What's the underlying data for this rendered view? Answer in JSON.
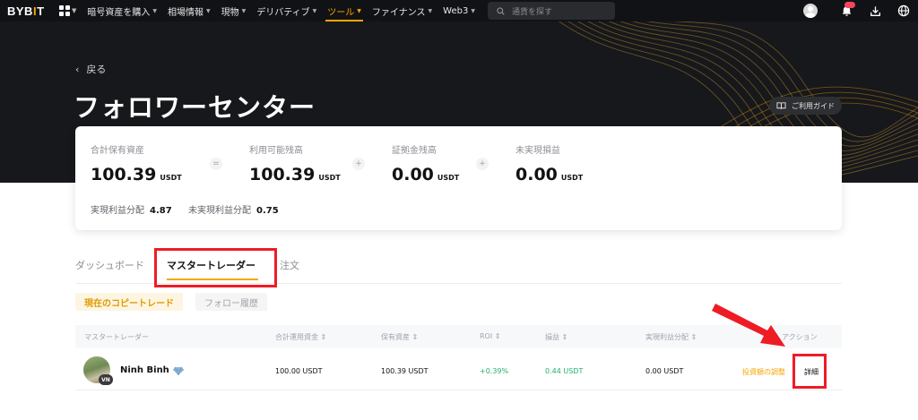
{
  "brand": {
    "logo_main": "BYB",
    "logo_i": "I",
    "logo_end": "T"
  },
  "nav": {
    "items": [
      {
        "label": "暗号資産を購入"
      },
      {
        "label": "相場情報"
      },
      {
        "label": "現物"
      },
      {
        "label": "デリバティブ"
      },
      {
        "label": "ツール"
      },
      {
        "label": "ファイナンス"
      },
      {
        "label": "Web3"
      }
    ],
    "active": "ツール",
    "search_placeholder": "通貨を探す"
  },
  "hero": {
    "back_label": "戻る",
    "title": "フォロワーセンター",
    "guide_label": "ご利用ガイド"
  },
  "summary": {
    "total_assets": {
      "label": "合計保有資産",
      "value": "100.39",
      "unit": "USDT"
    },
    "available": {
      "label": "利用可能残高",
      "value": "100.39",
      "unit": "USDT"
    },
    "margin": {
      "label": "証拠金残高",
      "value": "0.00",
      "unit": "USDT"
    },
    "unrealized": {
      "label": "未実現損益",
      "value": "0.00",
      "unit": "USDT"
    },
    "op_equals": "=",
    "op_plus": "+",
    "realized_share_label": "実現利益分配",
    "realized_share_value": "4.87",
    "unrealized_share_label": "未実現利益分配",
    "unrealized_share_value": "0.75"
  },
  "tabs": [
    {
      "label": "ダッシュボード"
    },
    {
      "label": "マスタートレーダー"
    },
    {
      "label": "注文"
    }
  ],
  "subtabs": {
    "current": "現在のコピートレード",
    "history": "フォロー履歴"
  },
  "table": {
    "headers": {
      "trader": "マスタートレーダー",
      "invested": "合計運用資金 ⇕",
      "holdings": "保有資産 ⇕",
      "roi": "ROI ⇕",
      "pnl": "損益 ⇕",
      "realized_share": "実現利益分配 ⇕",
      "action": "アクション"
    },
    "rows": [
      {
        "name": "Ninh Binh",
        "country": "VN",
        "invested": "100.00 USDT",
        "holdings": "100.39 USDT",
        "roi": "+0.39%",
        "pnl": "0.44 USDT",
        "realized_share": "0.00 USDT",
        "action_adjust": "投資額の調整",
        "action_detail": "詳細"
      }
    ]
  },
  "colors": {
    "accent": "#f7a600",
    "positive": "#20b26c",
    "annotation": "#ee1c25",
    "hero_bg": "#17181c"
  }
}
